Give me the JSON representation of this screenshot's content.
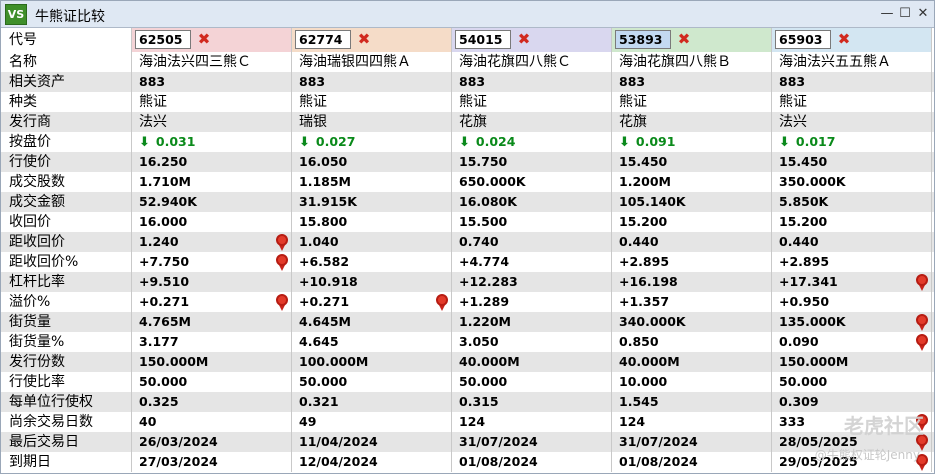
{
  "window": {
    "title": "牛熊证比较",
    "app_icon": "VS"
  },
  "chart_data": {
    "type": "table",
    "codes": [
      "62505",
      "62774",
      "54015",
      "53893",
      "65903"
    ],
    "selected_code": "53893",
    "header_colors": [
      "#f4d3d6",
      "#f5dcc8",
      "#d9d7ef",
      "#cfe8cd",
      "#d3e6f2"
    ],
    "rows": [
      {
        "label": "名称",
        "kind": "name",
        "values": [
          "海油法兴四三熊Ｃ",
          "海油瑞银四四熊Ａ",
          "海油花旗四八熊Ｃ",
          "海油花旗四八熊Ｂ",
          "海油法兴五五熊Ａ"
        ]
      },
      {
        "label": "相关资产",
        "values": [
          "883",
          "883",
          "883",
          "883",
          "883"
        ]
      },
      {
        "label": "种类",
        "kind": "name",
        "values": [
          "熊证",
          "熊证",
          "熊证",
          "熊证",
          "熊证"
        ]
      },
      {
        "label": "发行商",
        "kind": "name",
        "values": [
          "法兴",
          "瑞银",
          "花旗",
          "花旗",
          "法兴"
        ]
      },
      {
        "label": "按盘价",
        "kind": "price",
        "values": [
          "0.031",
          "0.027",
          "0.024",
          "0.091",
          "0.017"
        ]
      },
      {
        "label": "行使价",
        "values": [
          "16.250",
          "16.050",
          "15.750",
          "15.450",
          "15.450"
        ]
      },
      {
        "label": "成交股数",
        "values": [
          "1.710M",
          "1.185M",
          "650.000K",
          "1.200M",
          "350.000K"
        ]
      },
      {
        "label": "成交金额",
        "values": [
          "52.940K",
          "31.915K",
          "16.080K",
          "105.140K",
          "5.850K"
        ]
      },
      {
        "label": "收回价",
        "values": [
          "16.000",
          "15.800",
          "15.500",
          "15.200",
          "15.200"
        ]
      },
      {
        "label": "距收回价",
        "values": [
          "1.240",
          "1.040",
          "0.740",
          "0.440",
          "0.440"
        ],
        "medal": [
          true,
          false,
          false,
          false,
          false
        ]
      },
      {
        "label": "距收回价%",
        "values": [
          "+7.750",
          "+6.582",
          "+4.774",
          "+2.895",
          "+2.895"
        ],
        "medal": [
          true,
          false,
          false,
          false,
          false
        ]
      },
      {
        "label": "杠杆比率",
        "values": [
          "+9.510",
          "+10.918",
          "+12.283",
          "+16.198",
          "+17.341"
        ],
        "medal": [
          false,
          false,
          false,
          false,
          true
        ]
      },
      {
        "label": "溢价%",
        "values": [
          "+0.271",
          "+0.271",
          "+1.289",
          "+1.357",
          "+0.950"
        ],
        "medal": [
          true,
          true,
          false,
          false,
          false
        ]
      },
      {
        "label": "街货量",
        "values": [
          "4.765M",
          "4.645M",
          "1.220M",
          "340.000K",
          "135.000K"
        ],
        "medal": [
          false,
          false,
          false,
          false,
          true
        ]
      },
      {
        "label": "街货量%",
        "values": [
          "3.177",
          "4.645",
          "3.050",
          "0.850",
          "0.090"
        ],
        "medal": [
          false,
          false,
          false,
          false,
          true
        ]
      },
      {
        "label": "发行份数",
        "values": [
          "150.000M",
          "100.000M",
          "40.000M",
          "40.000M",
          "150.000M"
        ]
      },
      {
        "label": "行使比率",
        "values": [
          "50.000",
          "50.000",
          "50.000",
          "10.000",
          "50.000"
        ]
      },
      {
        "label": "每单位行使权",
        "values": [
          "0.325",
          "0.321",
          "0.315",
          "1.545",
          "0.309"
        ]
      },
      {
        "label": "尚余交易日数",
        "values": [
          "40",
          "49",
          "124",
          "124",
          "333"
        ],
        "medal": [
          false,
          false,
          false,
          false,
          true
        ]
      },
      {
        "label": "最后交易日",
        "values": [
          "26/03/2024",
          "11/04/2024",
          "31/07/2024",
          "31/07/2024",
          "28/05/2025"
        ],
        "medal": [
          false,
          false,
          false,
          false,
          true
        ]
      },
      {
        "label": "到期日",
        "values": [
          "27/03/2024",
          "12/04/2024",
          "01/08/2024",
          "01/08/2024",
          "29/05/2025"
        ],
        "medal": [
          false,
          false,
          false,
          false,
          true
        ]
      }
    ]
  },
  "header_label": "代号",
  "icons": {
    "remove": "close-x-icon",
    "down": "down-arrow-icon",
    "medal": "medal-icon"
  },
  "watermark": {
    "text": "老虎社区",
    "sub": "@牛熊权证轮Jenny"
  }
}
